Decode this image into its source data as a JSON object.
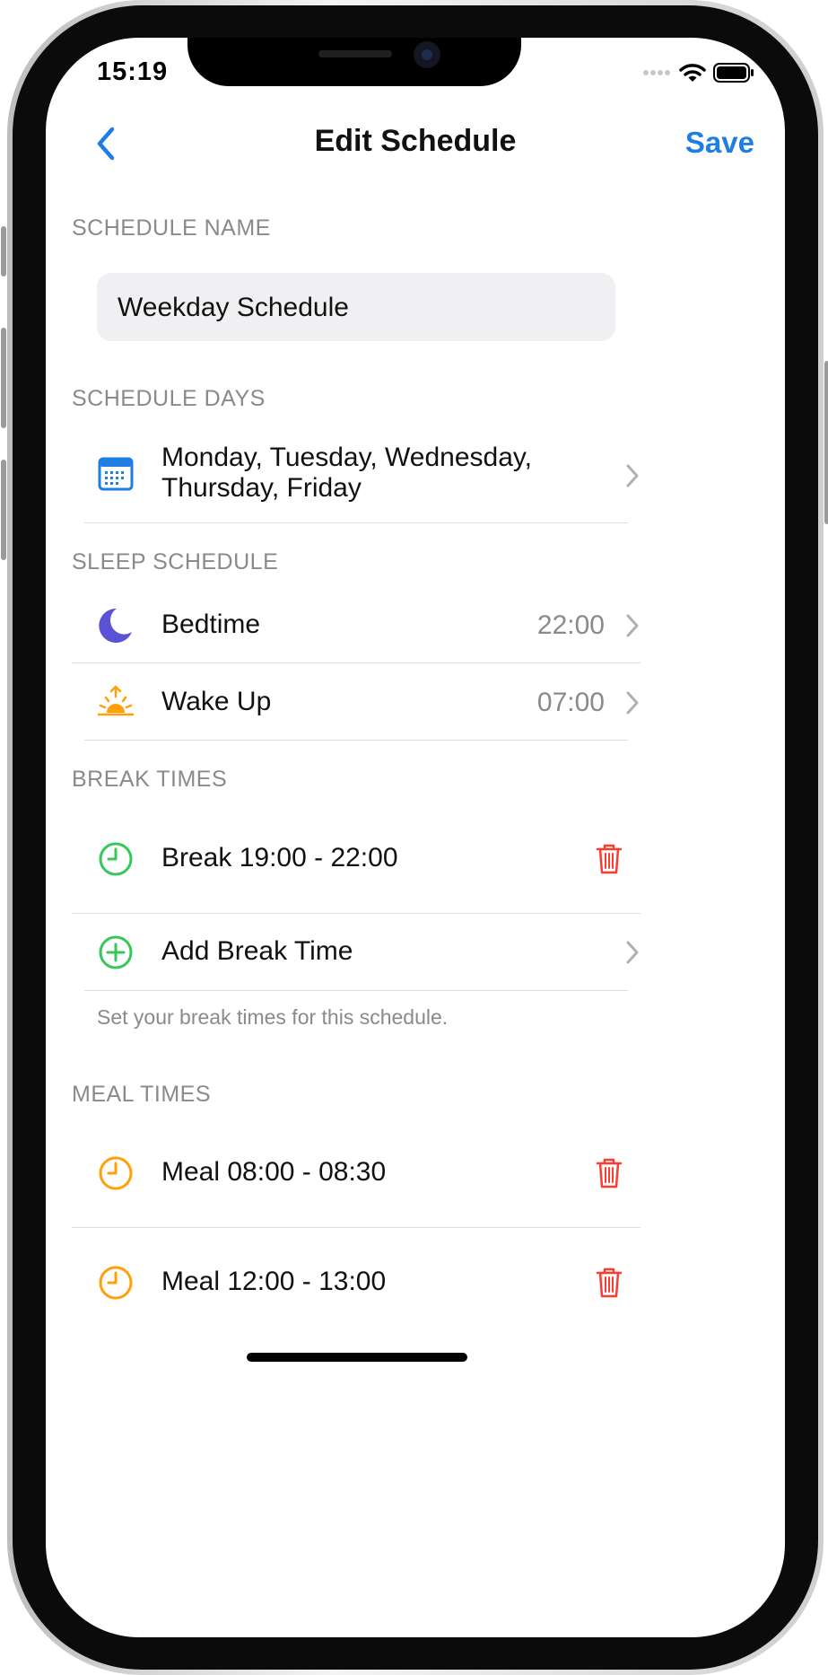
{
  "status": {
    "time": "15:19"
  },
  "nav": {
    "title": "Edit Schedule",
    "save_label": "Save"
  },
  "schedule_name": {
    "header": "SCHEDULE NAME",
    "value": "Weekday Schedule"
  },
  "schedule_days": {
    "header": "SCHEDULE DAYS",
    "line1": "Monday, Tuesday, Wednesday,",
    "line2": "Thursday, Friday"
  },
  "sleep": {
    "header": "SLEEP SCHEDULE",
    "bedtime_label": "Bedtime",
    "bedtime_value": "22:00",
    "wakeup_label": "Wake Up",
    "wakeup_value": "07:00"
  },
  "breaks": {
    "header": "BREAK TIMES",
    "items": [
      {
        "label": "Break 19:00 - 22:00"
      }
    ],
    "add_label": "Add Break Time",
    "footnote": "Set your break times for this schedule."
  },
  "meals": {
    "header": "MEAL TIMES",
    "items": [
      {
        "label": "Meal 08:00 - 08:30"
      },
      {
        "label": "Meal 12:00 - 13:00"
      }
    ]
  },
  "colors": {
    "accent": "#1f7fe0",
    "green": "#34c759",
    "orange": "#ff9f0a",
    "red": "#ff3b30",
    "indigo": "#5b52d6"
  },
  "icons": [
    "back-chevron-icon",
    "calendar-icon",
    "moon-icon",
    "sunrise-icon",
    "clock-icon",
    "add-circle-icon",
    "trash-icon",
    "chevron-right-icon",
    "wifi-icon",
    "battery-icon",
    "signal-icon"
  ]
}
